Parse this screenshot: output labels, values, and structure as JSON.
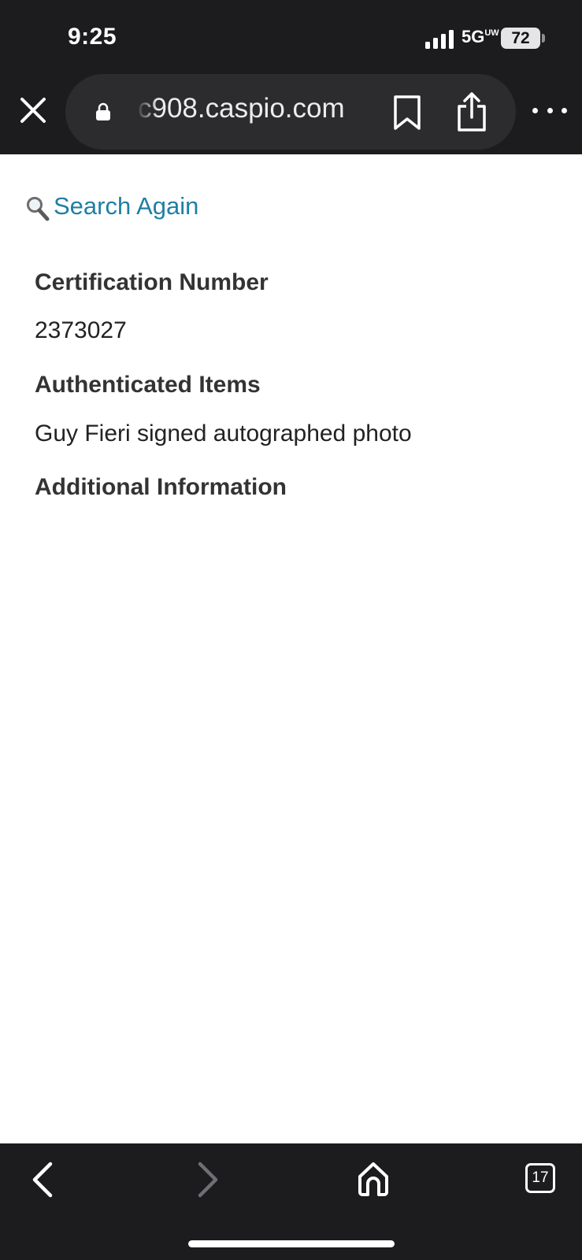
{
  "status_bar": {
    "time": "9:25",
    "network": "5G",
    "network_suffix": "UW",
    "battery": "72"
  },
  "browser": {
    "url": "c908.caspio.com",
    "tab_count": "17"
  },
  "page": {
    "search_again_label": "Search Again",
    "cert_number_label": "Certification Number",
    "cert_number_value": "2373027",
    "items_label": "Authenticated Items",
    "items_value": "Guy Fieri signed autographed photo",
    "additional_info_label": "Additional Information"
  },
  "colors": {
    "link": "#1f7fa3",
    "chrome_background": "#1c1c1e",
    "url_pill": "#2c2c2e"
  }
}
